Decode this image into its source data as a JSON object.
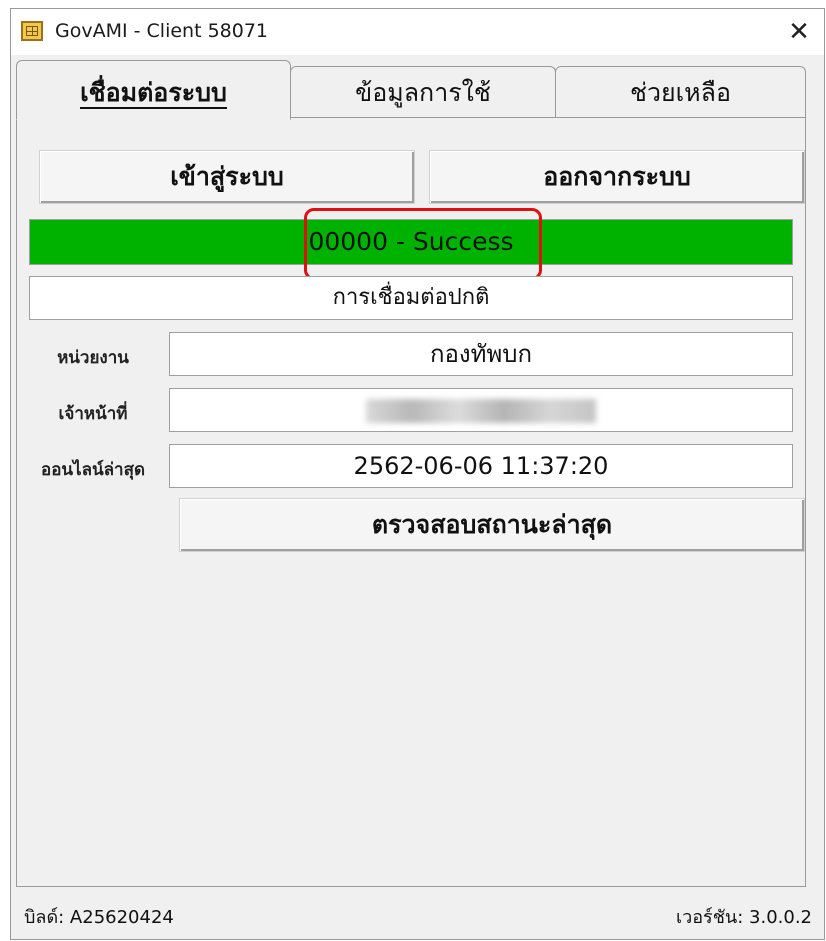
{
  "window": {
    "title": "GovAMI - Client 58071",
    "close_glyph": "✕"
  },
  "tabs": [
    {
      "label": "เชื่อมต่อระบบ",
      "active": true
    },
    {
      "label": "ข้อมูลการใช้",
      "active": false
    },
    {
      "label": "ช่วยเหลือ",
      "active": false
    }
  ],
  "connection": {
    "login_label": "เข้าสู่ระบบ",
    "logout_label": "ออกจากระบบ",
    "status_text": "00000 - Success",
    "status_color": "#00b200",
    "highlight_color": "#e01010",
    "message": "การเชื่อมต่อปกติ",
    "unit_label": "หน่วยงาน",
    "unit_value": "กองทัพบก",
    "officer_label": "เจ้าหน้าที่",
    "officer_value": "",
    "last_online_label": "ออนไลน์ล่าสุด",
    "last_online_value": "2562-06-06 11:37:20",
    "check_status_label": "ตรวจสอบสถานะล่าสุด"
  },
  "footer": {
    "build": "บิลด์: A25620424",
    "version": "เวอร์ชัน: 3.0.0.2"
  }
}
